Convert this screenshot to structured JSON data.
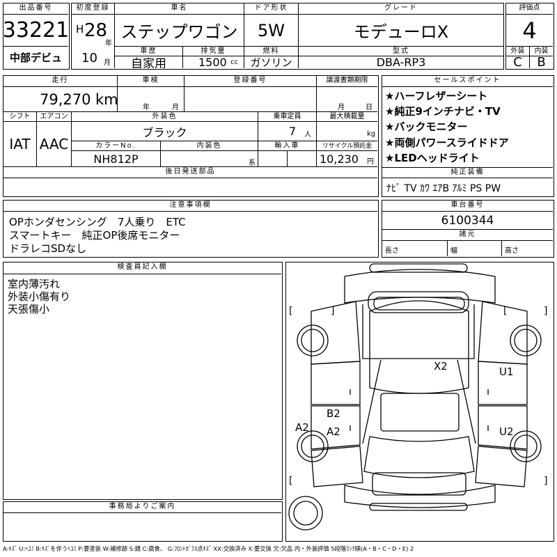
{
  "header": {
    "lot_no_label": "出品番号",
    "lot_no": "33221",
    "first_reg_label": "初度登録",
    "era": "H",
    "year": "28",
    "year_unit": "年",
    "month": "10",
    "month_unit": "月",
    "car_name_label": "車名",
    "car_name": "ステップワゴン",
    "door_label": "ドア形状",
    "door": "5W",
    "grade_label": "グレード",
    "grade": "モデューロX",
    "score_label": "評価点",
    "score": "4",
    "history_label": "車歴",
    "history": "自家用",
    "displacement_label": "排気量",
    "displacement": "1500",
    "displacement_unit": "cc",
    "fuel_label": "燃料",
    "fuel": "ガソリン",
    "model_label": "型式",
    "model": "DBA-RP3",
    "exterior_label": "外装",
    "exterior": "C",
    "interior_label": "内装",
    "interior": "B",
    "venue": "中部デビュ"
  },
  "row2": {
    "mileage_label": "走行",
    "mileage": "79,270",
    "mileage_unit": "km",
    "inspection_label": "車検",
    "inspection_year_unit": "年",
    "inspection_month_unit": "月",
    "reg_no_label": "登録番号",
    "transfer_label": "譲渡書類期限",
    "transfer_month_unit": "月",
    "transfer_day_unit": "日",
    "shift_label": "シフト",
    "shift": "IAT",
    "ac_label": "エアコン",
    "ac": "AAC",
    "ext_color_label": "外装色",
    "ext_color": "ブラック",
    "seats_label": "乗車定員",
    "seats": "7",
    "seats_unit": "人",
    "max_load_label": "最大積載量",
    "max_load_unit": "kg",
    "color_no_label": "カラーNo.",
    "color_no": "NH812P",
    "int_color_label": "内装色",
    "int_color_unit": "系",
    "import_label": "輸入車",
    "recycle_label": "リサイクル預託金",
    "recycle": "10,230",
    "recycle_unit": "円",
    "parts_label": "後日発送部品"
  },
  "sales_points": {
    "label": "セールスポイント",
    "items": [
      "★ハーフレザーシート",
      "★純正9インチナビ・TV",
      "★バックモニター",
      "★両側パワースライドドア",
      "★LEDヘッドライト"
    ]
  },
  "equipment": {
    "label": "純正装備",
    "value": "ﾅﾋﾞ TV ｶﾜ ｴｱB ｱﾙﾐ PS PW"
  },
  "notes": {
    "label": "注意事項欄",
    "lines": [
      "OPホンダセンシング　7人乗り　ETC",
      "スマートキー　純正OP後席モニター",
      "ドラレコSDなし"
    ]
  },
  "chassis": {
    "label": "車台番号",
    "value": "6100344",
    "dims_label": "諸元",
    "length_label": "長さ",
    "width_label": "幅",
    "height_label": "高さ"
  },
  "inspector": {
    "label": "検査員記入欄",
    "lines": [
      "室内薄汚れ",
      "外装小傷有り",
      "天張傷小"
    ]
  },
  "office": {
    "label": "事務局よりご案内"
  },
  "damage_marks": [
    {
      "code": "X2",
      "part": "roof"
    },
    {
      "code": "U1",
      "part": "right-rear-door"
    },
    {
      "code": "U2",
      "part": "right-front-door"
    },
    {
      "code": "B2",
      "part": "left-front-door"
    },
    {
      "code": "A2",
      "part": "left-front-door"
    },
    {
      "code": "A2",
      "part": "left-front-fender"
    }
  ],
  "legend": "A:ｷｽﾞ U:ﾍｺﾐ B:ｷｽﾞを伴うﾍｺﾐ P:要塗装 W:補修跡 S:錆 C:腐食、 G:ﾌﾛﾝﾄｶﾞﾗｽ点ｷｽﾞ XX:交換済み X:要交換 欠:欠品 内・外装評価 5段階ﾗﾝｸ順(A・B・C・D・E) 2"
}
